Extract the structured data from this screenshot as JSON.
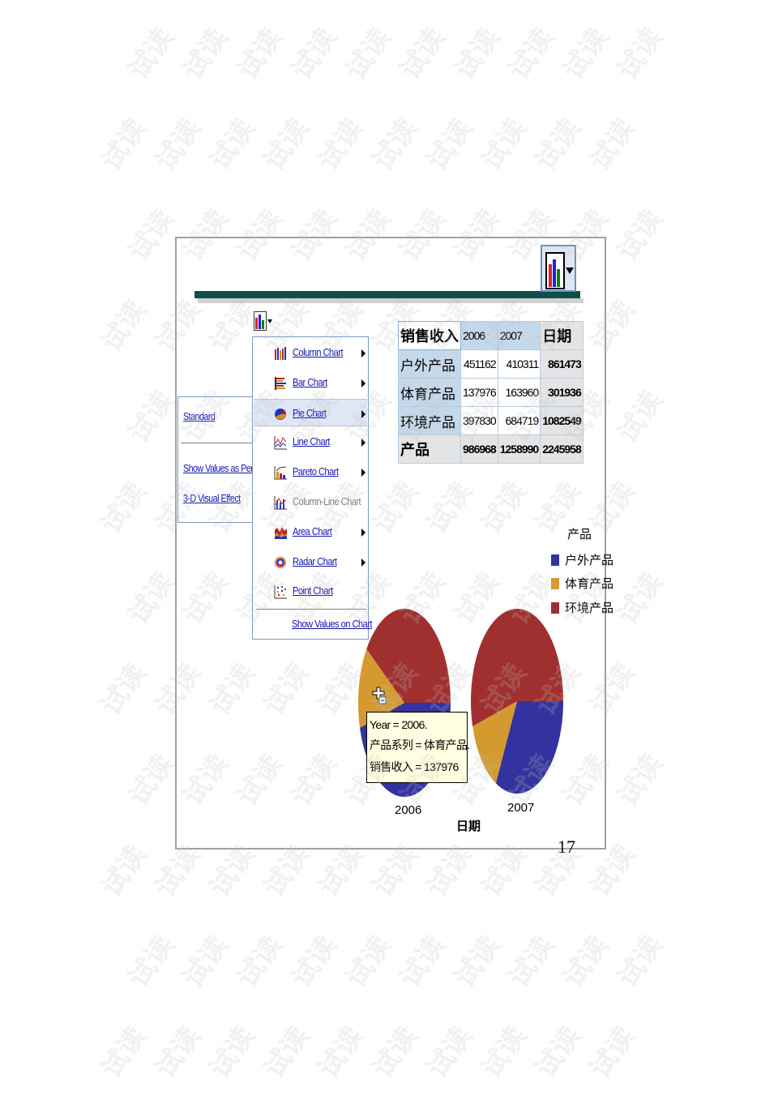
{
  "toolbar": {
    "chart_type_button_icon": "column-chart-icon",
    "chart_menu_button_icon": "column-chart-icon"
  },
  "chart_menu": {
    "items": [
      {
        "label": "Column Chart",
        "icon": "column-chart-icon",
        "has_submenu": true,
        "enabled": true,
        "highlighted": false
      },
      {
        "label": "Bar Chart",
        "icon": "bar-chart-icon",
        "has_submenu": true,
        "enabled": true,
        "highlighted": false
      },
      {
        "label": "Pie Chart",
        "icon": "pie-chart-icon",
        "has_submenu": true,
        "enabled": true,
        "highlighted": true
      },
      {
        "label": "Line Chart",
        "icon": "line-chart-icon",
        "has_submenu": true,
        "enabled": true,
        "highlighted": false
      },
      {
        "label": "Pareto Chart",
        "icon": "pareto-chart-icon",
        "has_submenu": true,
        "enabled": true,
        "highlighted": false
      },
      {
        "label": "Column-Line Chart",
        "icon": "column-line-chart-icon",
        "has_submenu": false,
        "enabled": false,
        "highlighted": false
      },
      {
        "label": "Area Chart",
        "icon": "area-chart-icon",
        "has_submenu": true,
        "enabled": true,
        "highlighted": false
      },
      {
        "label": "Radar Chart",
        "icon": "radar-chart-icon",
        "has_submenu": true,
        "enabled": true,
        "highlighted": false
      },
      {
        "label": "Point Chart",
        "icon": "point-chart-icon",
        "has_submenu": false,
        "enabled": true,
        "highlighted": false
      }
    ],
    "show_values_label": "Show Values on Chart"
  },
  "pie_submenu": {
    "standard": "Standard",
    "show_percent": "Show Values as Percent",
    "visual_3d": "3-D Visual Effect"
  },
  "pivot_table": {
    "measure": "销售收入",
    "columns": [
      "2006",
      "2007"
    ],
    "total_column": "日期",
    "rows": [
      {
        "label": "户外产品",
        "values": [
          "451162",
          "410311"
        ],
        "total": "861473"
      },
      {
        "label": "体育产品",
        "values": [
          "137976",
          "163960"
        ],
        "total": "301936"
      },
      {
        "label": "环境产品",
        "values": [
          "397830",
          "684719"
        ],
        "total": "1082549"
      }
    ],
    "total_row": {
      "label": "产品",
      "values": [
        "986968",
        "1258990"
      ],
      "total": "2245958"
    }
  },
  "chart_data": {
    "type": "pie",
    "title": "",
    "xlabel": "日期",
    "legend_title": "产品",
    "legend_position": "right",
    "categories": [
      "户外产品",
      "体育产品",
      "环境产品"
    ],
    "colors": [
      "#3333a0",
      "#d49a30",
      "#a03030"
    ],
    "pies": [
      {
        "label": "2006",
        "values": [
          451162,
          137976,
          397830
        ]
      },
      {
        "label": "2007",
        "values": [
          410311,
          163960,
          684719
        ]
      }
    ]
  },
  "tooltip": {
    "line1": "Year = 2006.",
    "line2": "产品系列 = 体育产品.",
    "line3": "销售收入 = 137976"
  },
  "page": {
    "number": "17",
    "watermark": "试读"
  }
}
